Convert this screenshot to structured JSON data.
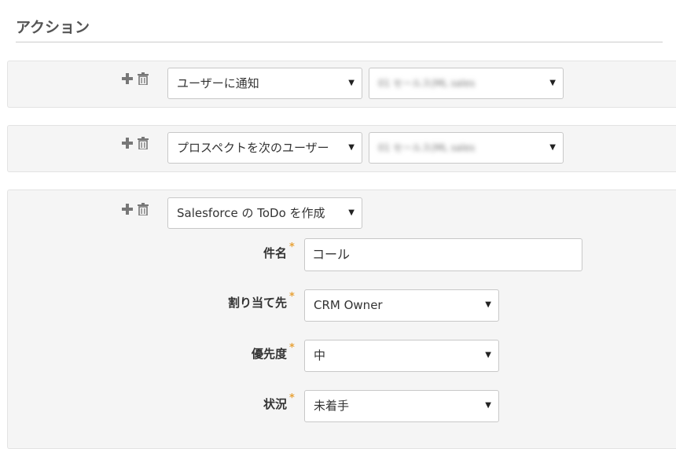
{
  "section": {
    "title": "アクション"
  },
  "actions": [
    {
      "type": "ユーザーに通知",
      "target": "01 セールス(ML sales"
    },
    {
      "type": "プロスペクトを次のユーザー",
      "target": "01 セールス(ML sales"
    },
    {
      "type": "Salesforce の ToDo を作成"
    }
  ],
  "todo": {
    "subject": {
      "label": "件名",
      "required_mark": "*",
      "value": "コール"
    },
    "assignee": {
      "label": "割り当て先",
      "required_mark": "*",
      "value": "CRM Owner"
    },
    "priority": {
      "label": "優先度",
      "required_mark": "*",
      "value": "中"
    },
    "status": {
      "label": "状況",
      "required_mark": "*",
      "value": "未着手"
    }
  },
  "colors": {
    "required": "#e8a33a",
    "row_bg": "#f5f5f5",
    "icon": "#777777"
  },
  "icons": {
    "add": "plus-icon",
    "delete": "trash-icon",
    "dropdown": "caret-down-icon"
  }
}
